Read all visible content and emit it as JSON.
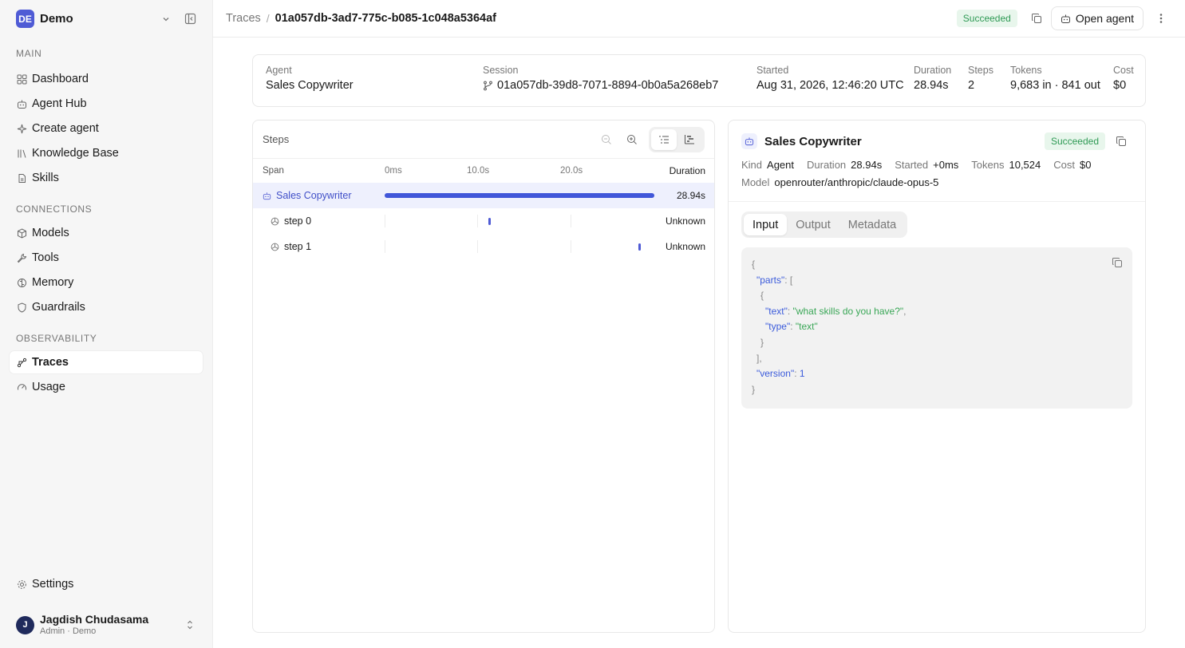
{
  "workspace": {
    "badge": "DE",
    "name": "Demo"
  },
  "sidebar": {
    "sections": [
      {
        "title": "MAIN",
        "items": [
          {
            "label": "Dashboard",
            "icon": "grid-icon"
          },
          {
            "label": "Agent Hub",
            "icon": "bot-icon"
          },
          {
            "label": "Create agent",
            "icon": "sparkle-icon"
          },
          {
            "label": "Knowledge Base",
            "icon": "library-icon"
          },
          {
            "label": "Skills",
            "icon": "file-icon"
          }
        ]
      },
      {
        "title": "CONNECTIONS",
        "items": [
          {
            "label": "Models",
            "icon": "cube-icon"
          },
          {
            "label": "Tools",
            "icon": "wrench-icon"
          },
          {
            "label": "Memory",
            "icon": "brain-icon"
          },
          {
            "label": "Guardrails",
            "icon": "shield-icon"
          }
        ]
      },
      {
        "title": "OBSERVABILITY",
        "items": [
          {
            "label": "Traces",
            "icon": "route-icon",
            "active": true
          },
          {
            "label": "Usage",
            "icon": "gauge-icon"
          }
        ]
      }
    ],
    "settings_label": "Settings",
    "user": {
      "initial": "J",
      "name": "Jagdish Chudasama",
      "role": "Admin · Demo"
    }
  },
  "topbar": {
    "crumb_root": "Traces",
    "crumb_sep": "/",
    "trace_id": "01a057db-3ad7-775c-b085-1c048a5364af",
    "status": "Succeeded",
    "open_agent_label": "Open agent"
  },
  "summary": {
    "agent_label": "Agent",
    "agent": "Sales Copywriter",
    "session_label": "Session",
    "session": "01a057db-39d8-7071-8894-0b0a5a268eb7",
    "started_label": "Started",
    "started": "Aug 31, 2026, 12:46:20 UTC",
    "duration_label": "Duration",
    "duration": "28.94s",
    "steps_label": "Steps",
    "steps": "2",
    "tokens_label": "Tokens",
    "tokens": "9,683 in · 841 out",
    "cost_label": "Cost",
    "cost": "$0"
  },
  "steps_panel": {
    "title": "Steps",
    "col_span": "Span",
    "col_duration": "Duration",
    "time_ticks": [
      "0ms",
      "10.0s",
      "20.0s"
    ],
    "rows": [
      {
        "name": "Sales Copywriter",
        "duration": "28.94s",
        "start_frac": 0.0,
        "width_frac": 1.0,
        "selected": true
      },
      {
        "name": "step 0",
        "duration": "Unknown",
        "marker_frac": 0.385
      },
      {
        "name": "step 1",
        "duration": "Unknown",
        "marker_frac": 0.94
      }
    ]
  },
  "detail": {
    "title": "Sales Copywriter",
    "status": "Succeeded",
    "kind_label": "Kind",
    "kind": "Agent",
    "duration_label": "Duration",
    "duration": "28.94s",
    "started_label": "Started",
    "started": "+0ms",
    "tokens_label": "Tokens",
    "tokens": "10,524",
    "cost_label": "Cost",
    "cost": "$0",
    "model_label": "Model",
    "model": "openrouter/anthropic/claude-opus-5",
    "tabs": [
      "Input",
      "Output",
      "Metadata"
    ],
    "json": {
      "parts_key": "\"parts\"",
      "text_key": "\"text\"",
      "text_val": "\"what skills do you have?\"",
      "type_key": "\"type\"",
      "type_val": "\"text\"",
      "version_key": "\"version\"",
      "version_val": "1"
    }
  },
  "colors": {
    "accent": "#4f5bd5",
    "bar": "#4157d9",
    "success_bg": "#e8f6ec",
    "success_fg": "#2f9a55"
  }
}
